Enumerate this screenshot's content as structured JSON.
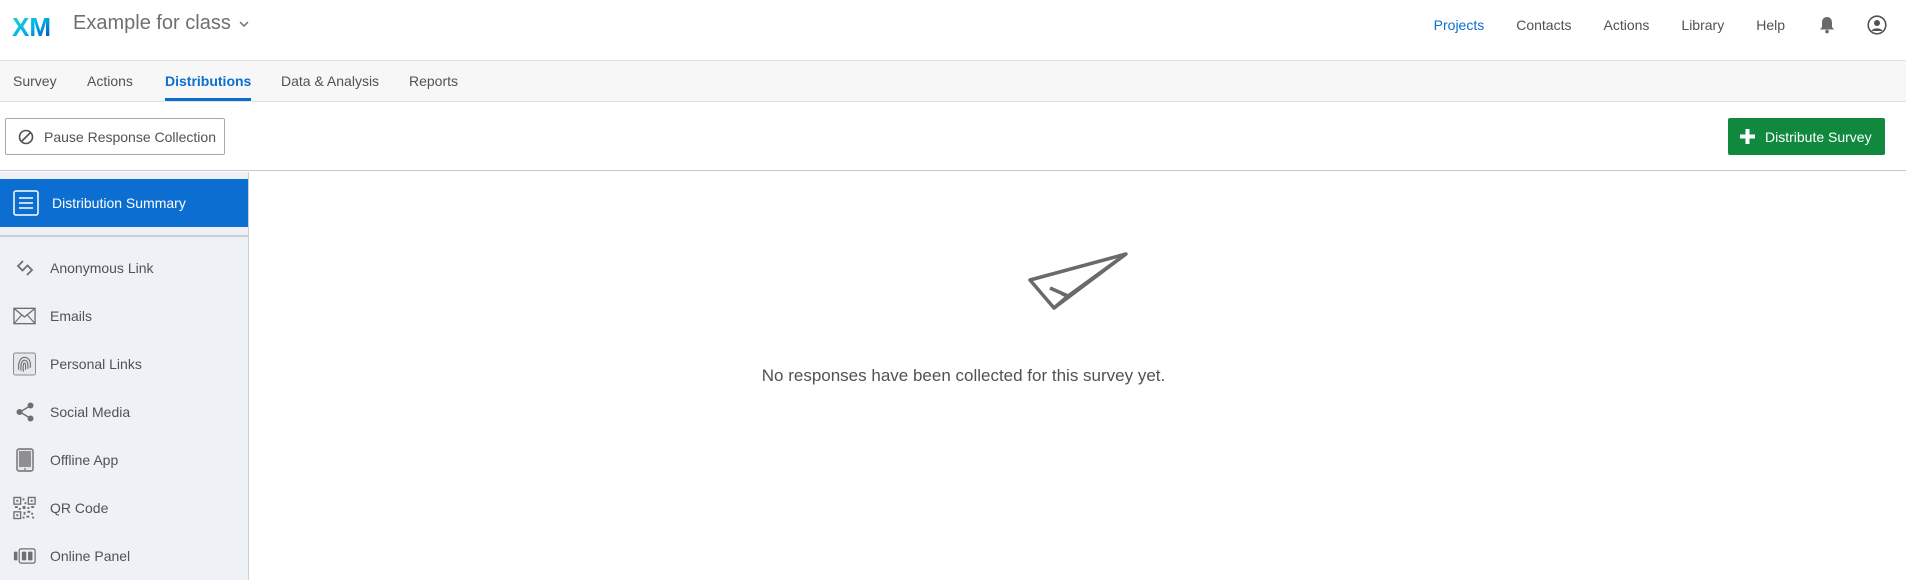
{
  "header": {
    "logo_text": "XM",
    "project_title": "Example for class",
    "nav": [
      {
        "label": "Projects",
        "active": true
      },
      {
        "label": "Contacts",
        "active": false
      },
      {
        "label": "Actions",
        "active": false
      },
      {
        "label": "Library",
        "active": false
      },
      {
        "label": "Help",
        "active": false
      }
    ],
    "icons": [
      "bell-icon",
      "user-account-icon"
    ]
  },
  "tabs": [
    {
      "label": "Survey",
      "active": false
    },
    {
      "label": "Actions",
      "active": false
    },
    {
      "label": "Distributions",
      "active": true
    },
    {
      "label": "Data & Analysis",
      "active": false
    },
    {
      "label": "Reports",
      "active": false
    }
  ],
  "toolbar": {
    "pause_label": "Pause Response Collection",
    "distribute_label": "Distribute Survey"
  },
  "sidebar": {
    "active_label": "Distribution Summary",
    "items": [
      {
        "label": "Anonymous Link",
        "icon": "link-icon"
      },
      {
        "label": "Emails",
        "icon": "envelope-icon"
      },
      {
        "label": "Personal Links",
        "icon": "fingerprint-icon"
      },
      {
        "label": "Social Media",
        "icon": "share-icon"
      },
      {
        "label": "Offline App",
        "icon": "tablet-icon"
      },
      {
        "label": "QR Code",
        "icon": "qr-code-icon"
      },
      {
        "label": "Online Panel",
        "icon": "panel-icon"
      }
    ]
  },
  "main": {
    "empty_message": "No responses have been collected for this survey yet."
  },
  "colors": {
    "accent_blue": "#0b6ed0",
    "success_green": "#10893e",
    "sidebar_bg": "#eef1f5",
    "text": "#525252"
  }
}
